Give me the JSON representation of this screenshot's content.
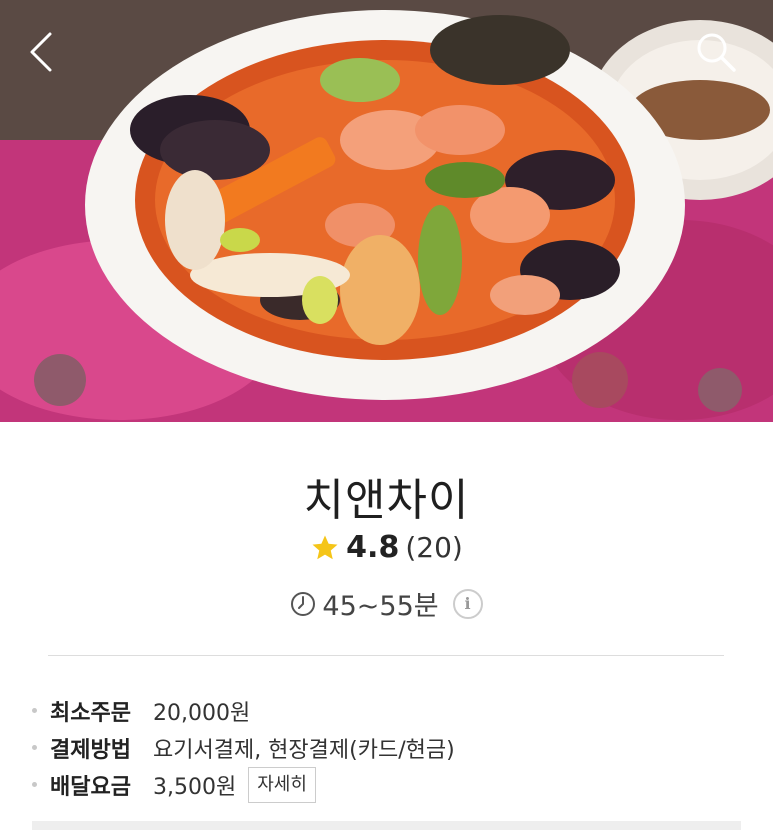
{
  "header": {
    "back_icon": "chevron-left-icon",
    "search_icon": "search-icon"
  },
  "restaurant": {
    "name": "치앤차이",
    "rating": "4.8",
    "review_count": "(20)",
    "delivery_time": "45~55분"
  },
  "details": {
    "min_order_label": "최소주문",
    "min_order_value": "20,000원",
    "payment_label": "결제방법",
    "payment_value": "요기서결제, 현장결제(카드/현금)",
    "delivery_fee_label": "배달요금",
    "delivery_fee_value": "3,500원",
    "more_label": "자세히"
  },
  "colors": {
    "star": "#f5c518",
    "accent_pink": "#c23f7c"
  }
}
